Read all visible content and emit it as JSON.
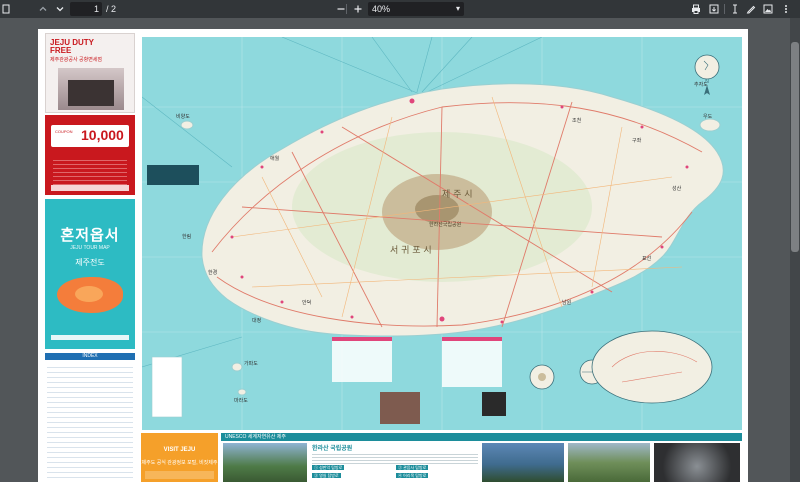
{
  "toolbar": {
    "current_page": "1",
    "page_total": "/ 2",
    "zoom": "40%",
    "icons": [
      "sidebar-toggle-icon",
      "prev-page-icon",
      "next-page-icon",
      "zoom-out-icon",
      "zoom-in-icon",
      "print-icon",
      "save-icon",
      "text-select-icon",
      "draw-icon",
      "image-icon",
      "more-icon"
    ]
  },
  "brochure": {
    "dutyfree_brand": "JEJU DUTY FREE",
    "dutyfree_sub": "제주관광공사 공항면세점",
    "coupon_value": "10,000",
    "coupon_label": "COUPON",
    "cover_title": "혼저옵서",
    "cover_subtitle": "JEJU TOUR MAP",
    "cover_region": "제주전도",
    "index_header": "INDEX",
    "visit_title": "VISIT JEJU",
    "visit_sub": "제주도 공식 관광정보 포털, 비짓제주",
    "unesco_heading": "UNESCO 세계자연유산 제주",
    "info_title": "한라산 국립공원",
    "trail_1": "① 성판악 탐방로",
    "trail_2": "② 관음사 탐방로",
    "trail_3": "③ 영실 탐방로",
    "trail_4": "④ 어리목 탐방로"
  },
  "map": {
    "label_jejusi": "제 주 시",
    "label_seogwiposi": "서 귀 포 시",
    "label_hallasan": "한라산국립공원",
    "label_hallim": "한림",
    "label_aewol": "애월",
    "label_jocheon": "조천",
    "label_gujwa": "구좌",
    "label_seongsan": "성산",
    "label_pyoseon": "표선",
    "label_namwon": "남원",
    "label_andeok": "안덕",
    "label_daejeong": "대정",
    "label_hangyeong": "한경",
    "label_udo": "우도",
    "label_marado": "마라도",
    "label_gapado": "가파도",
    "label_biyangdo": "비양도",
    "label_chujado": "추자도"
  },
  "colors": {
    "toolbar_bg": "#323639",
    "viewer_bg": "#525659",
    "sea": "#8ed9dd",
    "land": "#f2efe3",
    "mountain": "#cbbd9c",
    "brand_red": "#c9181e",
    "brand_teal": "#2dbbc3",
    "visit_orange": "#f5a02a"
  }
}
